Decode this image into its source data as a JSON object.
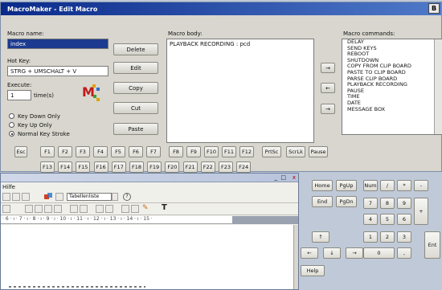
{
  "dialog": {
    "title": "MacroMaker - Edit Macro",
    "close_glyph": "B",
    "macro_name_label": "Macro name:",
    "macro_name_value": "index",
    "hotkey_label": "Hot Key:",
    "hotkey_value": "STRG + UMSCHALT + V",
    "execute_label": "Execute:",
    "execute_value": "1",
    "execute_unit": "time(s)",
    "radios": [
      {
        "label": "Key Down Only",
        "checked": false
      },
      {
        "label": "Key Up Only",
        "checked": false
      },
      {
        "label": "Normal Key Stroke",
        "checked": true
      }
    ],
    "buttons": {
      "delete": "Delete",
      "edit": "Edit",
      "copy": "Copy",
      "cut": "Cut",
      "paste": "Paste"
    },
    "body_label": "Macro body:",
    "body_text": "PLAYBACK RECORDING : pcd",
    "commands_label": "Macro commands:",
    "commands": [
      "DELAY",
      "SEND KEYS",
      "REBOOT",
      "SHUTDOWN",
      "COPY FROM CLIP BOARD",
      "PASTE TO CLIP BOARD",
      "PARSE CLIP BOARD",
      "PLAYBACK RECORDING",
      "PAUSE",
      "TIME",
      "DATE",
      "MESSAGE BOX"
    ],
    "move_buttons": {
      "right": "→",
      "left": "←",
      "right2": "→"
    }
  },
  "keyboard": {
    "row1": [
      "Esc",
      "F1",
      "F2",
      "F3",
      "F4",
      "F5",
      "F6",
      "F7",
      "F8",
      "F9",
      "F10",
      "F11",
      "F12",
      "PrtSc",
      "ScrLk",
      "Pause"
    ],
    "row2": [
      "F13",
      "F14",
      "F15",
      "F16",
      "F17",
      "F18",
      "F19",
      "F20",
      "F21",
      "F22",
      "F23",
      "F24"
    ],
    "nav1": [
      "Home",
      "PgUp"
    ],
    "nav2": [
      "End",
      "PgDn"
    ],
    "arrow_up": "↑",
    "arrows_bottom": [
      "←",
      "↓",
      "→"
    ],
    "numpad": {
      "r1": [
        "Num",
        "/",
        "*",
        "-"
      ],
      "r2": [
        "7",
        "8",
        "9"
      ],
      "plus": "+",
      "r3": [
        "4",
        "5",
        "6"
      ],
      "r4": [
        "1",
        "2",
        "3"
      ],
      "enter": "Ent",
      "zero": "0",
      "dot": ","
    },
    "help": "Help"
  },
  "word": {
    "menu_fragment": "Hilfe",
    "style_value": "Tabellenliste",
    "ruler_text": "· 6 · ı · 7 · ı · 8 · ı · 9 · ı · 10 · ı · 11 · ı · 12 · ı · 13 · ı · 14 · ı · 15 ·",
    "win_controls": [
      "_",
      "□",
      "x"
    ]
  }
}
